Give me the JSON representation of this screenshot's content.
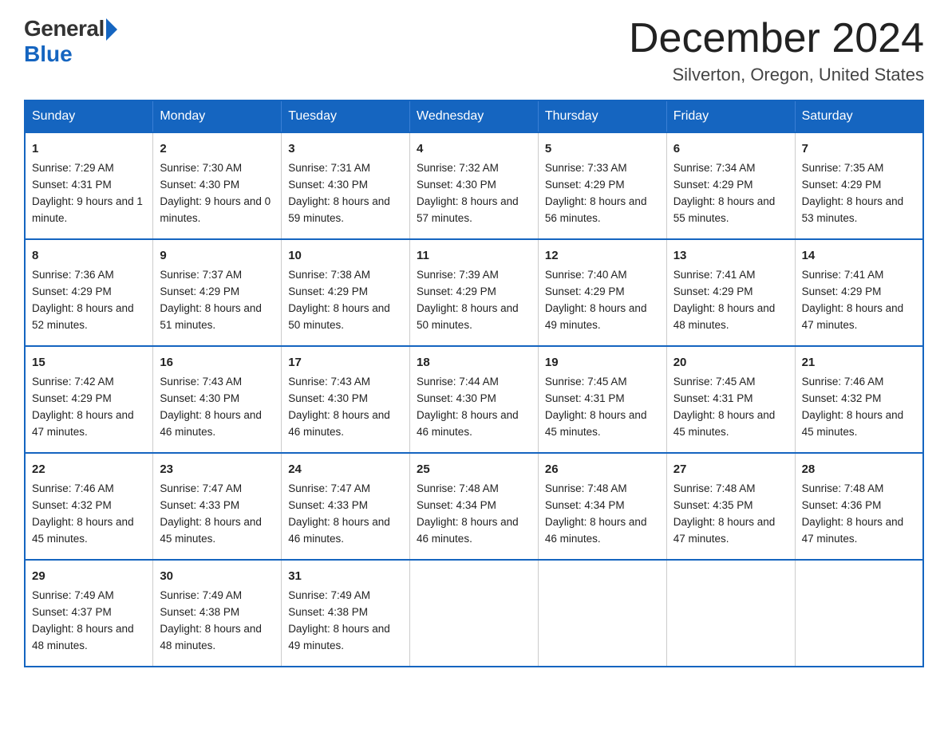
{
  "header": {
    "logo_general": "General",
    "logo_blue": "Blue",
    "title": "December 2024",
    "location": "Silverton, Oregon, United States"
  },
  "days_of_week": [
    "Sunday",
    "Monday",
    "Tuesday",
    "Wednesday",
    "Thursday",
    "Friday",
    "Saturday"
  ],
  "weeks": [
    [
      {
        "day": "1",
        "sunrise": "7:29 AM",
        "sunset": "4:31 PM",
        "daylight": "9 hours and 1 minute."
      },
      {
        "day": "2",
        "sunrise": "7:30 AM",
        "sunset": "4:30 PM",
        "daylight": "9 hours and 0 minutes."
      },
      {
        "day": "3",
        "sunrise": "7:31 AM",
        "sunset": "4:30 PM",
        "daylight": "8 hours and 59 minutes."
      },
      {
        "day": "4",
        "sunrise": "7:32 AM",
        "sunset": "4:30 PM",
        "daylight": "8 hours and 57 minutes."
      },
      {
        "day": "5",
        "sunrise": "7:33 AM",
        "sunset": "4:29 PM",
        "daylight": "8 hours and 56 minutes."
      },
      {
        "day": "6",
        "sunrise": "7:34 AM",
        "sunset": "4:29 PM",
        "daylight": "8 hours and 55 minutes."
      },
      {
        "day": "7",
        "sunrise": "7:35 AM",
        "sunset": "4:29 PM",
        "daylight": "8 hours and 53 minutes."
      }
    ],
    [
      {
        "day": "8",
        "sunrise": "7:36 AM",
        "sunset": "4:29 PM",
        "daylight": "8 hours and 52 minutes."
      },
      {
        "day": "9",
        "sunrise": "7:37 AM",
        "sunset": "4:29 PM",
        "daylight": "8 hours and 51 minutes."
      },
      {
        "day": "10",
        "sunrise": "7:38 AM",
        "sunset": "4:29 PM",
        "daylight": "8 hours and 50 minutes."
      },
      {
        "day": "11",
        "sunrise": "7:39 AM",
        "sunset": "4:29 PM",
        "daylight": "8 hours and 50 minutes."
      },
      {
        "day": "12",
        "sunrise": "7:40 AM",
        "sunset": "4:29 PM",
        "daylight": "8 hours and 49 minutes."
      },
      {
        "day": "13",
        "sunrise": "7:41 AM",
        "sunset": "4:29 PM",
        "daylight": "8 hours and 48 minutes."
      },
      {
        "day": "14",
        "sunrise": "7:41 AM",
        "sunset": "4:29 PM",
        "daylight": "8 hours and 47 minutes."
      }
    ],
    [
      {
        "day": "15",
        "sunrise": "7:42 AM",
        "sunset": "4:29 PM",
        "daylight": "8 hours and 47 minutes."
      },
      {
        "day": "16",
        "sunrise": "7:43 AM",
        "sunset": "4:30 PM",
        "daylight": "8 hours and 46 minutes."
      },
      {
        "day": "17",
        "sunrise": "7:43 AM",
        "sunset": "4:30 PM",
        "daylight": "8 hours and 46 minutes."
      },
      {
        "day": "18",
        "sunrise": "7:44 AM",
        "sunset": "4:30 PM",
        "daylight": "8 hours and 46 minutes."
      },
      {
        "day": "19",
        "sunrise": "7:45 AM",
        "sunset": "4:31 PM",
        "daylight": "8 hours and 45 minutes."
      },
      {
        "day": "20",
        "sunrise": "7:45 AM",
        "sunset": "4:31 PM",
        "daylight": "8 hours and 45 minutes."
      },
      {
        "day": "21",
        "sunrise": "7:46 AM",
        "sunset": "4:32 PM",
        "daylight": "8 hours and 45 minutes."
      }
    ],
    [
      {
        "day": "22",
        "sunrise": "7:46 AM",
        "sunset": "4:32 PM",
        "daylight": "8 hours and 45 minutes."
      },
      {
        "day": "23",
        "sunrise": "7:47 AM",
        "sunset": "4:33 PM",
        "daylight": "8 hours and 45 minutes."
      },
      {
        "day": "24",
        "sunrise": "7:47 AM",
        "sunset": "4:33 PM",
        "daylight": "8 hours and 46 minutes."
      },
      {
        "day": "25",
        "sunrise": "7:48 AM",
        "sunset": "4:34 PM",
        "daylight": "8 hours and 46 minutes."
      },
      {
        "day": "26",
        "sunrise": "7:48 AM",
        "sunset": "4:34 PM",
        "daylight": "8 hours and 46 minutes."
      },
      {
        "day": "27",
        "sunrise": "7:48 AM",
        "sunset": "4:35 PM",
        "daylight": "8 hours and 47 minutes."
      },
      {
        "day": "28",
        "sunrise": "7:48 AM",
        "sunset": "4:36 PM",
        "daylight": "8 hours and 47 minutes."
      }
    ],
    [
      {
        "day": "29",
        "sunrise": "7:49 AM",
        "sunset": "4:37 PM",
        "daylight": "8 hours and 48 minutes."
      },
      {
        "day": "30",
        "sunrise": "7:49 AM",
        "sunset": "4:38 PM",
        "daylight": "8 hours and 48 minutes."
      },
      {
        "day": "31",
        "sunrise": "7:49 AM",
        "sunset": "4:38 PM",
        "daylight": "8 hours and 49 minutes."
      },
      {
        "day": "",
        "sunrise": "",
        "sunset": "",
        "daylight": ""
      },
      {
        "day": "",
        "sunrise": "",
        "sunset": "",
        "daylight": ""
      },
      {
        "day": "",
        "sunrise": "",
        "sunset": "",
        "daylight": ""
      },
      {
        "day": "",
        "sunrise": "",
        "sunset": "",
        "daylight": ""
      }
    ]
  ],
  "labels": {
    "sunrise_prefix": "Sunrise: ",
    "sunset_prefix": "Sunset: ",
    "daylight_prefix": "Daylight: "
  }
}
